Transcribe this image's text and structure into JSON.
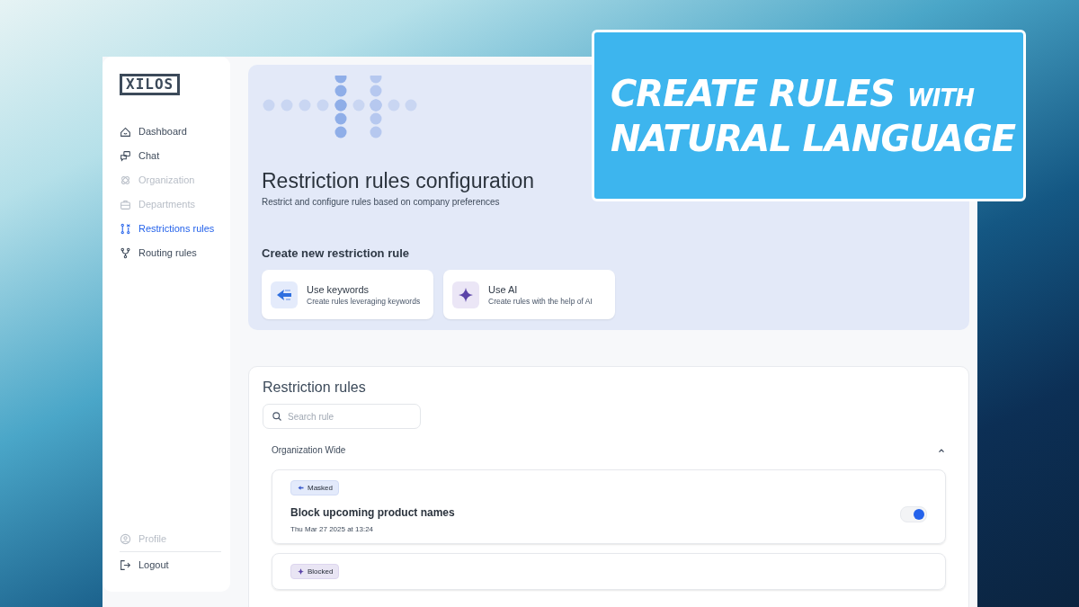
{
  "banner": {
    "lines": [
      {
        "parts": [
          {
            "text": "CREATE RULES",
            "kind": "large"
          },
          {
            "text": "WITH",
            "kind": "small"
          }
        ]
      },
      {
        "parts": [
          {
            "text": "NATURAL LANGUAGE",
            "kind": "large"
          }
        ]
      }
    ]
  },
  "sidebar": {
    "logo": "XILOS",
    "items": [
      {
        "label": "Dashboard",
        "selected": false,
        "disabled": false
      },
      {
        "label": "Chat",
        "selected": false,
        "disabled": false
      },
      {
        "label": "Organization",
        "selected": false,
        "disabled": true
      },
      {
        "label": "Departments",
        "selected": false,
        "disabled": true
      },
      {
        "label": "Restrictions rules",
        "selected": true,
        "disabled": false
      },
      {
        "label": "Routing rules",
        "selected": false,
        "disabled": false
      }
    ],
    "footer_items": [
      {
        "label": "Profile",
        "disabled": true
      },
      {
        "label": "Logout",
        "disabled": false
      }
    ]
  },
  "hero": {
    "title": "Restriction rules configuration",
    "subtitle": "Restrict and configure rules based on company preferences",
    "section_title": "Create new restriction rule",
    "options": [
      {
        "kind": "keywords",
        "title": "Use keywords",
        "description": "Create rules leveraging keywords"
      },
      {
        "kind": "ai",
        "title": "Use AI",
        "description": "Create rules with the help of AI"
      }
    ]
  },
  "rules": {
    "title": "Restriction rules",
    "search": {
      "placeholder": "Search rule"
    },
    "group": {
      "title": "Organization Wide",
      "expanded": true
    },
    "items": [
      {
        "tag": {
          "kind": "masked",
          "label": "Masked"
        },
        "name": "Block upcoming product names",
        "date": "Thu Mar 27 2025 at 13:24",
        "on": true
      },
      {
        "tag": {
          "kind": "blocked",
          "label": "Blocked"
        }
      }
    ]
  }
}
